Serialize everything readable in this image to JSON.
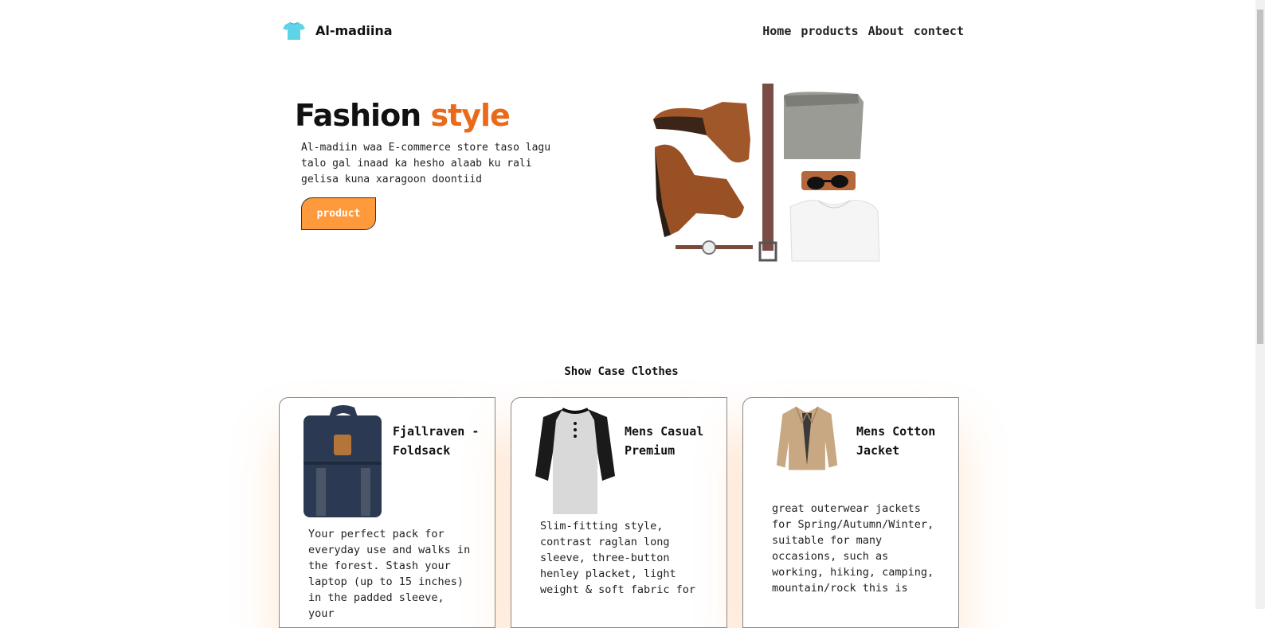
{
  "brand": {
    "name": "Al-madiina"
  },
  "nav": {
    "home": "Home",
    "products": "products",
    "about": "About",
    "contact": "contect"
  },
  "hero": {
    "title_main": "Fashion",
    "title_accent": "style",
    "description": "Al-madiin waa E-commerce store taso lagu talo gal inaad ka hesho alaab ku rali gelisa kuna xaragoon doontiid",
    "button": "product"
  },
  "showcase": {
    "title": "Show Case Clothes",
    "cards": [
      {
        "title": "Fjallraven - Foldsack",
        "description": "Your perfect pack for everyday use and walks in the forest. Stash your laptop (up to 15 inches) in the padded sleeve, your"
      },
      {
        "title": "Mens Casual Premium",
        "description": "Slim-fitting style, contrast raglan long sleeve, three-button henley placket, light weight & soft fabric for"
      },
      {
        "title": "Mens Cotton Jacket",
        "description": "great outerwear jackets for Spring/Autumn/Winter, suitable for many occasions, such as working, hiking, camping, mountain/rock this is"
      }
    ]
  },
  "colors": {
    "accent": "#ea6a1a",
    "button": "#ff9a3c",
    "logo": "#5fd3e8"
  },
  "icons": {
    "logo": "tshirt-icon"
  }
}
